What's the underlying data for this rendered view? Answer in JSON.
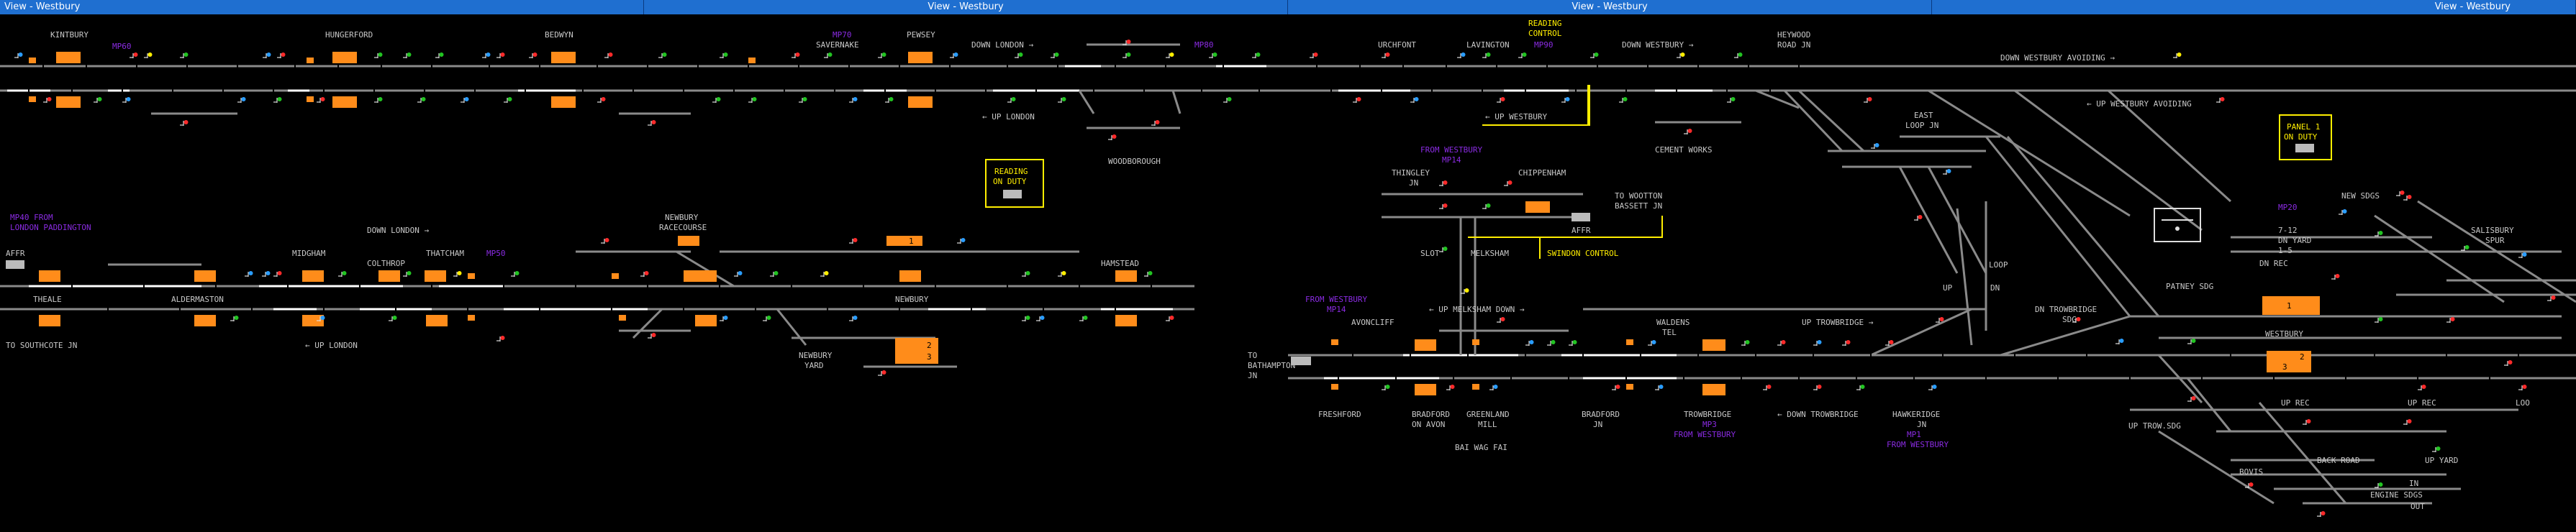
{
  "windows": [
    {
      "title": "View - Westbury"
    },
    {
      "title": "View - Westbury"
    },
    {
      "title": "View - Westbury"
    },
    {
      "title": "View - Westbury"
    }
  ],
  "colors": {
    "bg": "#000000",
    "track": "#8a8a8a",
    "track_active": "#ffffff",
    "label": "#c8c8c8",
    "mp": "#8a2be2",
    "berth": "#ff8c1a",
    "signal_red": "#ff2a2a",
    "signal_green": "#22c422",
    "signal_yellow": "#ffee00",
    "signal_blue": "#2a9dff",
    "box": "#ffee00",
    "window_title": "#1f6fd0"
  },
  "labels": {
    "kintbury": "KINTBURY",
    "mp60": "MP60",
    "hungerford": "HUNGERFORD",
    "bedwyn": "BEDWYN",
    "mp70": "MP70",
    "savernake": "SAVERNAKE",
    "pewsey": "PEWSEY",
    "down_london_1": "DOWN LONDON →",
    "mp80": "MP80",
    "urchfont": "URCHFONT",
    "lavington": "LAVINGTON",
    "mp90": "MP90",
    "reading_control_1": "READING",
    "reading_control_2": "CONTROL",
    "down_westbury": "DOWN WESTBURY →",
    "heywood_1": "HEYWOOD",
    "heywood_2": "ROAD JN",
    "down_westbury_avoiding": "DOWN WESTBURY AVOIDING →",
    "up_london_1": "← UP LONDON",
    "woodborough": "WOODBOROUGH",
    "up_westbury": "← UP WESTBURY",
    "cement_works": "CEMENT WORKS",
    "up_westbury_avoiding": "← UP WESTBURY AVOIDING",
    "east_loop_1": "EAST",
    "east_loop_2": "LOOP JN",
    "panel1_1": "PANEL 1",
    "panel1_2": "ON DUTY",
    "reading_on_duty_1": "READING",
    "reading_on_duty_2": "ON DUTY",
    "mp40_from_1": "MP40 FROM",
    "mp40_from_2": "LONDON PADDINGTON",
    "down_london_2": "DOWN LONDON →",
    "newbury_rc_1": "NEWBURY",
    "newbury_rc_2": "RACECOURSE",
    "midgham": "MIDGHAM",
    "colthrop": "COLTHROP",
    "thatcham": "THATCHAM",
    "mp50": "MP50",
    "hamstead": "HAMSTEAD",
    "newbury": "NEWBURY",
    "thearle": "THEALE",
    "aldermaston": "ALDERMASTON",
    "up_london_2": "← UP LONDON",
    "to_southcote": "TO SOUTHCOTE JN",
    "newbury_yard_1": "NEWBURY",
    "newbury_yard_2": "YARD",
    "affr": "AFFR",
    "from_westbury_1": "FROM WESTBURY",
    "mp14_1": "MP14",
    "thingley_1": "THINGLEY",
    "thingley_2": "JN",
    "chippenham": "CHIPPENHAM",
    "to_wootton_1": "TO WOOTTON",
    "to_wootton_2": "BASSETT JN",
    "affr2": "AFFR",
    "slot": "SLOT",
    "melksham": "MELKSHAM",
    "swindon_control": "SWINDON CONTROL",
    "from_westbury_2": "FROM WESTBURY",
    "mp14_2": "MP14",
    "up_melksham": "← UP MELKSHAM DOWN →",
    "avoncliff": "AVONCLIFF",
    "waldens_1": "WALDENS",
    "waldens_2": "TEL",
    "up_trowbridge": "UP TROWBRIDGE →",
    "to_bath_1": "TO",
    "to_bath_2": "BATHAMPTON",
    "to_bath_3": "JN",
    "freshford": "FRESHFORD",
    "bradford_oa_1": "BRADFORD",
    "bradford_oa_2": "ON AVON",
    "greenland_1": "GREENLAND",
    "greenland_2": "MILL",
    "bradford_jn_1": "BRADFORD",
    "bradford_jn_2": "JN",
    "trowbridge": "TROWBRIDGE",
    "mp3_1": "MP3",
    "from_westbury_3": "FROM WESTBURY",
    "down_trowbridge": "← DOWN TROWBRIDGE",
    "hawkeridge_1": "HAWKERIDGE",
    "hawkeridge_2": "JN",
    "mp1": "MP1",
    "from_westbury_4": "FROM WESTBURY",
    "bai_wag_fai": "BAI WAG FAI",
    "loop_1": "LOOP",
    "up_1": "UP",
    "dn_1": "DN",
    "dn_trow_1": "DN TROWBRIDGE",
    "dn_trow_2": "SDG",
    "mp20": "MP20",
    "new_sdgs": "NEW SDGS",
    "c7_12": "7-12",
    "dn_yard": "DN YARD",
    "c1_5": "1-5",
    "salisbury_1": "SALISBURY",
    "salisbury_2": "SPUR",
    "dn_rec": "DN REC",
    "patney_sdg": "PATNEY SDG",
    "westbury": "WESTBURY",
    "up_rec_1": "UP REC",
    "up_rec_2": "UP REC",
    "loo": "LOO",
    "up_trow_sdg": "UP TROW.SDG",
    "back_road": "BACK ROAD",
    "up_yard": "UP YARD",
    "bovis": "BOVIS",
    "in": "IN",
    "engine_sdgs": "ENGINE SDGS",
    "out": "OUT"
  },
  "berths": {
    "b1": "1",
    "b2": "2",
    "b3": "3",
    "b1b": "1",
    "b2b": "2",
    "b3b": "3",
    "b1c": "1"
  }
}
